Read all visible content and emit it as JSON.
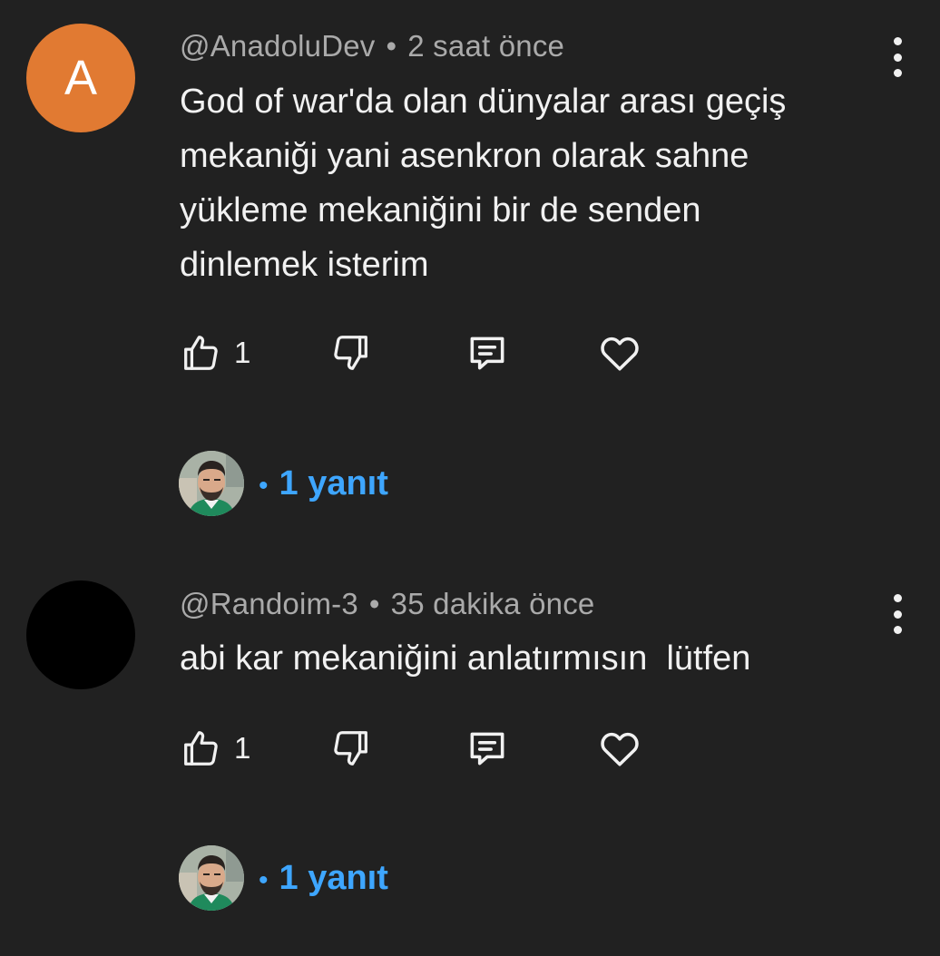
{
  "comments": [
    {
      "avatar_letter": "A",
      "avatar_color": "#e17a32",
      "handle": "@AnadoluDev",
      "time": "2 saat önce",
      "text": "God of war'da olan dünyalar arası geçiş\nmekaniği yani asenkron olarak sahne\nyükleme mekaniğini bir de senden\ndinlemek isterim",
      "like_count": "1",
      "replies_label": "1 yanıt"
    },
    {
      "avatar_letter": "",
      "avatar_color": "#000000",
      "handle": "@Randoim-3",
      "time": "35 dakika önce",
      "text": "abi kar mekaniğini anlatırmısın  lütfen",
      "like_count": "1",
      "replies_label": "1 yanıt"
    }
  ],
  "icons": {
    "like": "thumbs-up-icon",
    "dislike": "thumbs-down-icon",
    "reply": "comment-icon",
    "heart": "heart-icon",
    "more": "more-vertical-icon"
  },
  "colors": {
    "background": "#212121",
    "meta_text": "#aaaaaa",
    "reply_link": "#3ea6ff"
  }
}
